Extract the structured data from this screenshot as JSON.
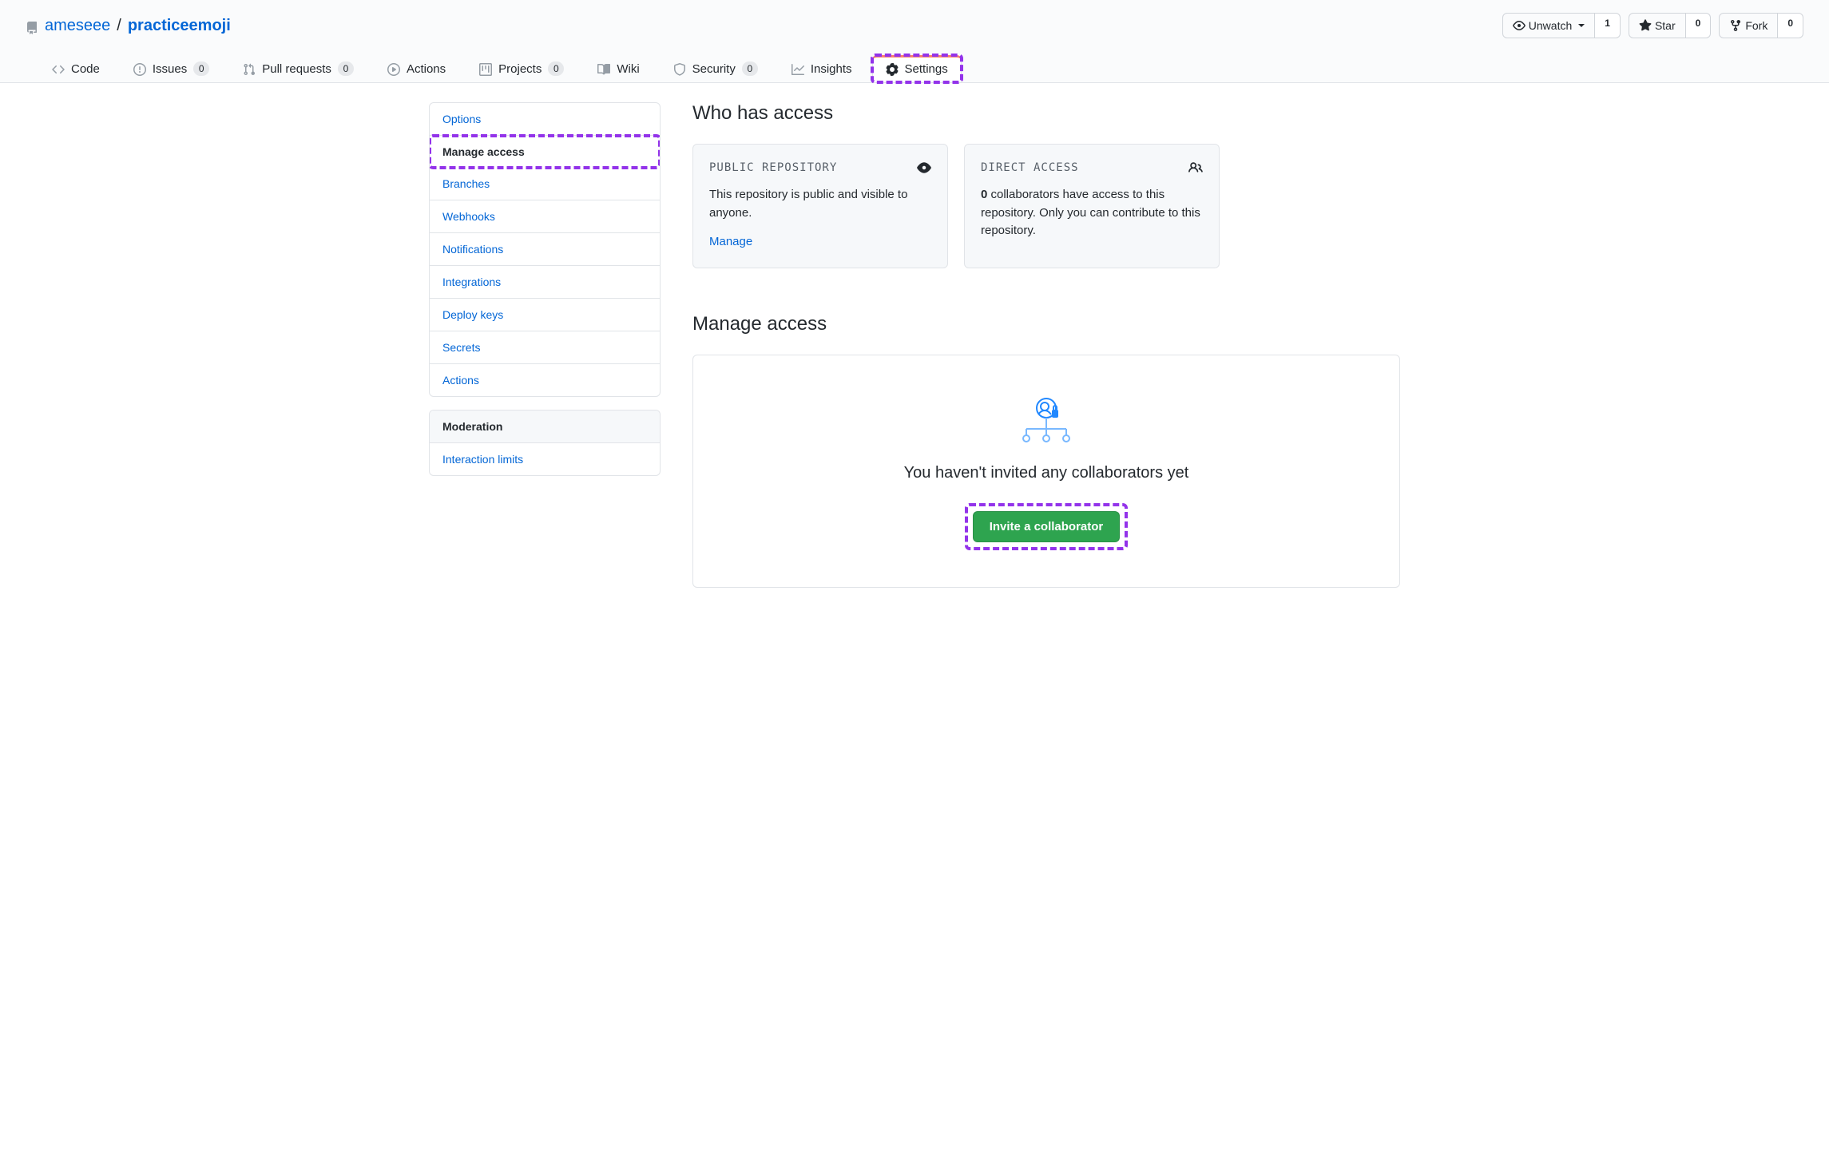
{
  "repo": {
    "owner": "ameseee",
    "name": "practiceemoji",
    "separator": "/"
  },
  "actions": {
    "unwatch": {
      "label": "Unwatch",
      "count": "1"
    },
    "star": {
      "label": "Star",
      "count": "0"
    },
    "fork": {
      "label": "Fork",
      "count": "0"
    }
  },
  "tabs": {
    "code": "Code",
    "issues": {
      "label": "Issues",
      "count": "0"
    },
    "pulls": {
      "label": "Pull requests",
      "count": "0"
    },
    "actions": "Actions",
    "projects": {
      "label": "Projects",
      "count": "0"
    },
    "wiki": "Wiki",
    "security": {
      "label": "Security",
      "count": "0"
    },
    "insights": "Insights",
    "settings": "Settings"
  },
  "sidebar": {
    "options": "Options",
    "manage_access": "Manage access",
    "branches": "Branches",
    "webhooks": "Webhooks",
    "notifications": "Notifications",
    "integrations": "Integrations",
    "deploy_keys": "Deploy keys",
    "secrets": "Secrets",
    "actions": "Actions",
    "moderation_heading": "Moderation",
    "interaction_limits": "Interaction limits"
  },
  "who_has_access": {
    "title": "Who has access",
    "public": {
      "title": "PUBLIC REPOSITORY",
      "body": "This repository is public and visible to anyone.",
      "link": "Manage"
    },
    "direct": {
      "title": "DIRECT ACCESS",
      "count": "0",
      "body_rest": " collaborators have access to this repository. Only you can contribute to this repository."
    }
  },
  "manage": {
    "title": "Manage access",
    "empty_heading": "You haven't invited any collaborators yet",
    "invite_label": "Invite a collaborator"
  }
}
